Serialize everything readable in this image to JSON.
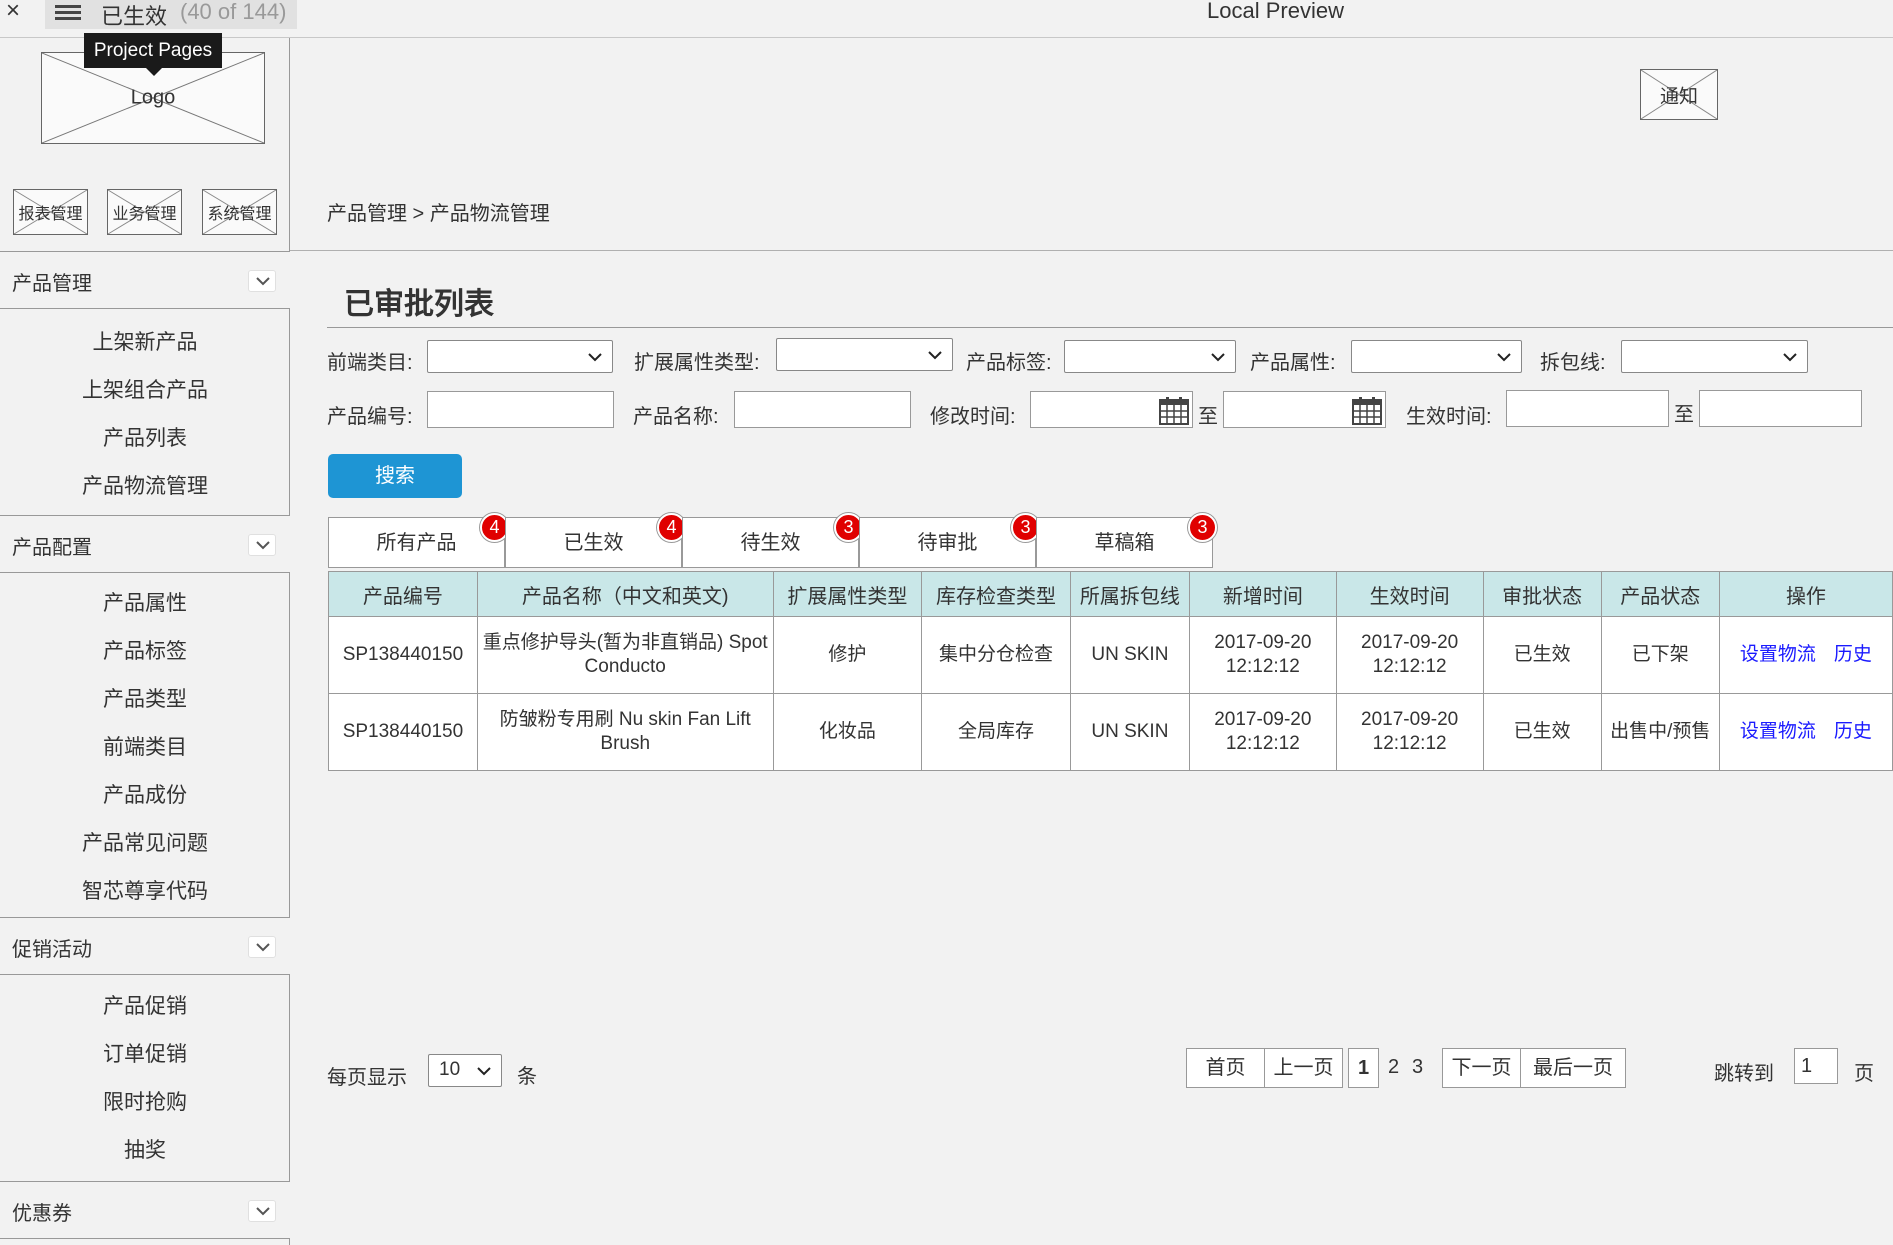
{
  "topbar": {
    "close_glyph": "×",
    "page_name": "已生效",
    "page_count": "(40 of 144)",
    "window_title": "Local Preview"
  },
  "sidebar": {
    "tooltip": "Project Pages",
    "logo_label": "Logo",
    "top_buttons": [
      "报表管理",
      "业务管理",
      "系统管理"
    ],
    "sections": [
      {
        "title": "产品管理",
        "items": [
          "上架新产品",
          "上架组合产品",
          "产品列表",
          "产品物流管理"
        ]
      },
      {
        "title": "产品配置",
        "items": [
          "产品属性",
          "产品标签",
          "产品类型",
          "前端类目",
          "产品成份",
          "产品常见问题",
          "智芯尊享代码"
        ]
      },
      {
        "title": "促销活动",
        "items": [
          "产品促销",
          "订单促销",
          "限时抢购",
          "抽奖"
        ]
      },
      {
        "title": "优惠券",
        "items": []
      }
    ]
  },
  "header": {
    "notify_label": "通知",
    "breadcrumb": "产品管理 >  产品物流管理"
  },
  "main": {
    "title": "已审批列表",
    "filters": {
      "frontend_category": "前端类目:",
      "ext_attr_type": "扩展属性类型:",
      "product_tag": "产品标签:",
      "product_attr": "产品属性:",
      "split_line": "拆包线:",
      "product_code": "产品编号:",
      "product_name": "产品名称:",
      "modified_time": "修改时间:",
      "effective_time": "生效时间:",
      "to": "至"
    },
    "search_label": "搜索",
    "tabs": [
      {
        "label": "所有产品",
        "count": "4"
      },
      {
        "label": "已生效",
        "count": "4"
      },
      {
        "label": "待生效",
        "count": "3"
      },
      {
        "label": "待审批",
        "count": "3"
      },
      {
        "label": "草稿箱",
        "count": "3"
      }
    ],
    "table": {
      "columns": [
        "产品编号",
        "产品名称（中文和英文)",
        "扩展属性类型",
        "库存检查类型",
        "所属拆包线",
        "新增时间",
        "生效时间",
        "审批状态",
        "产品状态",
        "操作"
      ],
      "rows": [
        {
          "code": "SP138440150",
          "name": "重点修护导头(暂为非直销品) Spot Conducto",
          "ext": "修护",
          "stock": "集中分仓检查",
          "line": "UN SKIN",
          "created": "2017-09-20 12:12:12",
          "effective": "2017-09-20 12:12:12",
          "approval": "已生效",
          "status": "已下架",
          "op1": "设置物流",
          "op2": "历史"
        },
        {
          "code": "SP138440150",
          "name": "防皱粉专用刷 Nu skin Fan Lift Brush",
          "ext": "化妆品",
          "stock": "全局库存",
          "line": "UN SKIN",
          "created": "2017-09-20 12:12:12",
          "effective": "2017-09-20 12:12:12",
          "approval": "已生效",
          "status": "出售中/预售",
          "op1": "设置物流",
          "op2": "历史"
        }
      ]
    },
    "pagination": {
      "per_page_label": "每页显示",
      "per_page_value": "10",
      "per_page_unit": "条",
      "first": "首页",
      "prev": "上一页",
      "pages": [
        "1",
        "2",
        "3"
      ],
      "current_page": "1",
      "next": "下一页",
      "last": "最后一页",
      "jump_label": "跳转到",
      "jump_value": "1",
      "jump_unit": "页"
    }
  }
}
